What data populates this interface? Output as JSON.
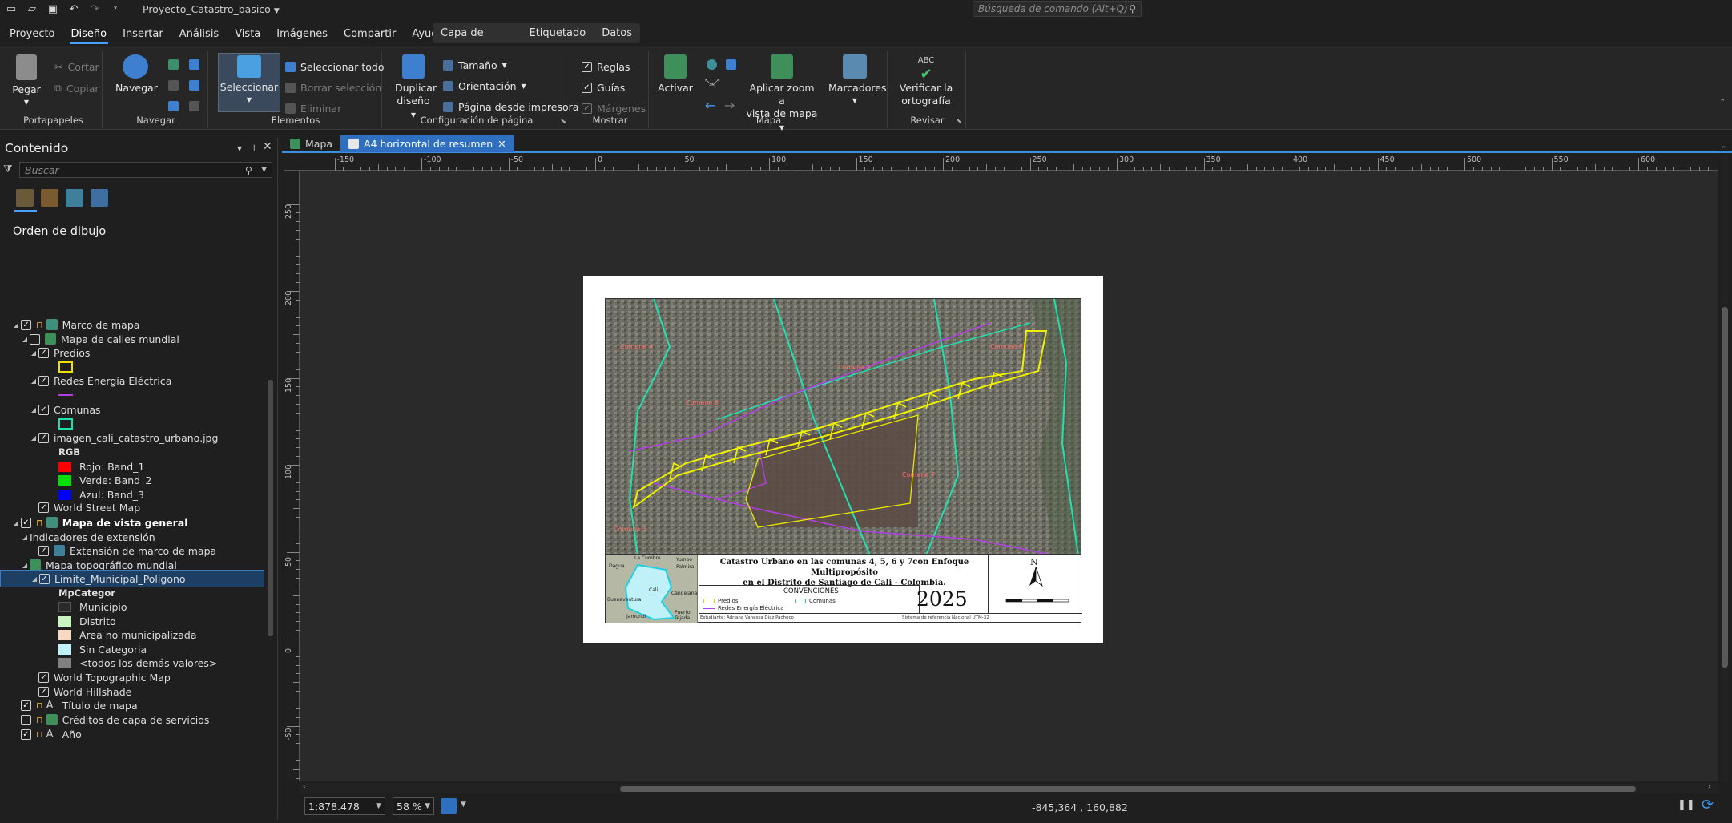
{
  "titlebar": {
    "project": "Proyecto_Catastro_basico",
    "command_search_placeholder": "Búsqueda de comando (Alt+Q)"
  },
  "menu": {
    "tabs": [
      "Proyecto",
      "Diseño",
      "Insertar",
      "Análisis",
      "Vista",
      "Imágenes",
      "Compartir",
      "Ayuda"
    ],
    "active": "Diseño",
    "context_tabs": [
      "Capa de entidades",
      "Etiquetado",
      "Datos"
    ]
  },
  "ribbon": {
    "portapapeles": {
      "label": "Portapapeles",
      "paste": "Pegar",
      "cut": "Cortar",
      "copy": "Copiar"
    },
    "navegar": {
      "label": "Navegar",
      "navigate": "Navegar"
    },
    "elementos": {
      "label": "Elementos",
      "select": "Seleccionar",
      "select_all": "Seleccionar todo",
      "clear_selection": "Borrar selección",
      "delete": "Eliminar"
    },
    "config_pagina": {
      "label": "Configuración de página",
      "duplicate_line1": "Duplicar",
      "duplicate_line2": "diseño",
      "size": "Tamaño",
      "orientation": "Orientación",
      "page_from_printer": "Página desde impresora"
    },
    "mostrar": {
      "label": "Mostrar",
      "rulers": "Reglas",
      "guides": "Guías",
      "margins": "Márgenes"
    },
    "mapa": {
      "label": "Mapa",
      "activate": "Activar",
      "zoom_line1": "Aplicar zoom a",
      "zoom_line2": "vista de mapa",
      "bookmarks": "Marcadores"
    },
    "revisar": {
      "label": "Revisar",
      "abc": "ABC",
      "spell_line1": "Verificar la",
      "spell_line2": "ortografía"
    }
  },
  "panel": {
    "title": "Contenido",
    "search_placeholder": "Buscar",
    "section": "Orden de dibujo",
    "rows": [
      {
        "text": "Marco de mapa",
        "indent": 1,
        "arrow": true,
        "check": true,
        "lock": true,
        "icon": "map-frame-icon",
        "bold": false
      },
      {
        "text": "Mapa de calles mundial",
        "indent": 2,
        "arrow": true,
        "check": false,
        "icon": "map-icon",
        "bold": false
      },
      {
        "text": "Predios",
        "indent": 3,
        "arrow": true,
        "check": true,
        "bold": false
      },
      {
        "swatch": "#f0e000",
        "swatch_style": "outline",
        "indent": 4
      },
      {
        "text": "Redes Energía Eléctrica",
        "indent": 3,
        "arrow": true,
        "check": true,
        "bold": false
      },
      {
        "swatch": "#b040e0",
        "swatch_style": "line",
        "indent": 4
      },
      {
        "text": "Comunas",
        "indent": 3,
        "arrow": true,
        "check": true,
        "bold": false
      },
      {
        "swatch": "#20e0b0",
        "swatch_style": "outline",
        "indent": 4
      },
      {
        "text": "imagen_cali_catastro_urbano.jpg",
        "indent": 3,
        "arrow": true,
        "check": true,
        "bold": false
      },
      {
        "text": "RGB",
        "indent": 4,
        "bold": false,
        "plain": true
      },
      {
        "text": "Rojo:  Band_1",
        "indent": 4,
        "swatch": "#ff0000",
        "swatch_style": "fill"
      },
      {
        "text": "Verde:  Band_2",
        "indent": 4,
        "swatch": "#00e000",
        "swatch_style": "fill"
      },
      {
        "text": "Azul:  Band_3",
        "indent": 4,
        "swatch": "#0000ff",
        "swatch_style": "fill"
      },
      {
        "text": "World Street Map",
        "indent": 3,
        "check": true,
        "bold": false
      },
      {
        "text": "Mapa de vista general",
        "indent": 1,
        "arrow": true,
        "check": true,
        "lock": true,
        "icon": "map-frame-icon",
        "bold": true
      },
      {
        "text": "Indicadores de extensión",
        "indent": 2,
        "arrow": true,
        "bold": false,
        "plain": true
      },
      {
        "text": "Extensión de marco de mapa",
        "indent": 3,
        "check": true,
        "icon": "extent-icon",
        "bold": false
      },
      {
        "text": "Mapa topográfico mundial",
        "indent": 2,
        "arrow": true,
        "icon": "map-icon",
        "bold": false
      },
      {
        "text": "Limite_Municipal_Poligono",
        "indent": 3,
        "arrow": true,
        "check": true,
        "bold": false,
        "selected": true
      },
      {
        "text": "MpCategor",
        "indent": 4,
        "bold": false,
        "plain": true
      },
      {
        "text": "Municipio",
        "indent": 4,
        "swatch": "#2a2a2a",
        "swatch_style": "fill"
      },
      {
        "text": "Distrito",
        "indent": 4,
        "swatch": "#c8f5c0",
        "swatch_style": "fill"
      },
      {
        "text": "Area no municipalizada",
        "indent": 4,
        "swatch": "#f8d8c0",
        "swatch_style": "fill"
      },
      {
        "text": "Sin Categoria",
        "indent": 4,
        "swatch": "#c0f0f8",
        "swatch_style": "fill"
      },
      {
        "text": "<todos los demás valores>",
        "indent": 4,
        "swatch": "#808080",
        "swatch_style": "fill"
      },
      {
        "text": "World Topographic Map",
        "indent": 3,
        "check": true,
        "bold": false
      },
      {
        "text": "World Hillshade",
        "indent": 3,
        "check": true,
        "bold": false
      },
      {
        "text": "Título de mapa",
        "indent": 1,
        "check": true,
        "lock": true,
        "icon": "text-icon",
        "bold": false
      },
      {
        "text": "Créditos de capa de servicios",
        "indent": 1,
        "check": false,
        "lock": true,
        "icon": "dynamic-text-icon",
        "bold": false
      },
      {
        "text": "Año",
        "indent": 1,
        "check": true,
        "lock": true,
        "icon": "text-icon",
        "bold": false
      }
    ]
  },
  "doc_tabs": [
    {
      "label": "Mapa",
      "active": false
    },
    {
      "label": "A4 horizontal de resumen",
      "active": true
    }
  ],
  "rulers": {
    "h": [
      "-150",
      "-100",
      "-50",
      "0",
      "50",
      "100",
      "150",
      "200",
      "250",
      "300",
      "350",
      "400",
      "450",
      "500",
      "550",
      "600"
    ],
    "v": [
      "250",
      "200",
      "150",
      "100",
      "50",
      "0",
      "-50"
    ]
  },
  "layout_page": {
    "title_line1": "Catastro Urbano en las comunas 4, 5, 6 y 7con Enfoque Multipropósito",
    "title_line2": "en el Distrito de Santiago de Cali - Colombia.",
    "conventions": "CONVENCIONES",
    "legend_predios": "Predios",
    "legend_redes": "Redes Energía Eléctrica",
    "legend_comunas": "Comunas",
    "year": "2025",
    "student": "Estudiante: Adriana Vanessa Díaz Pacheco",
    "reference": "Sistema de referencia Nacional UTM-32",
    "north": "N",
    "inset_labels": [
      "Yumbo",
      "La Cumbre",
      "Dagua",
      "Palmira",
      "Cali",
      "Candelaria",
      "Buenaventura",
      "Jamundí",
      "Puerto Tejada"
    ]
  },
  "status": {
    "scale": "1:878.478",
    "zoom": "58 %",
    "coordinates": "-845,364 , 160,882"
  }
}
